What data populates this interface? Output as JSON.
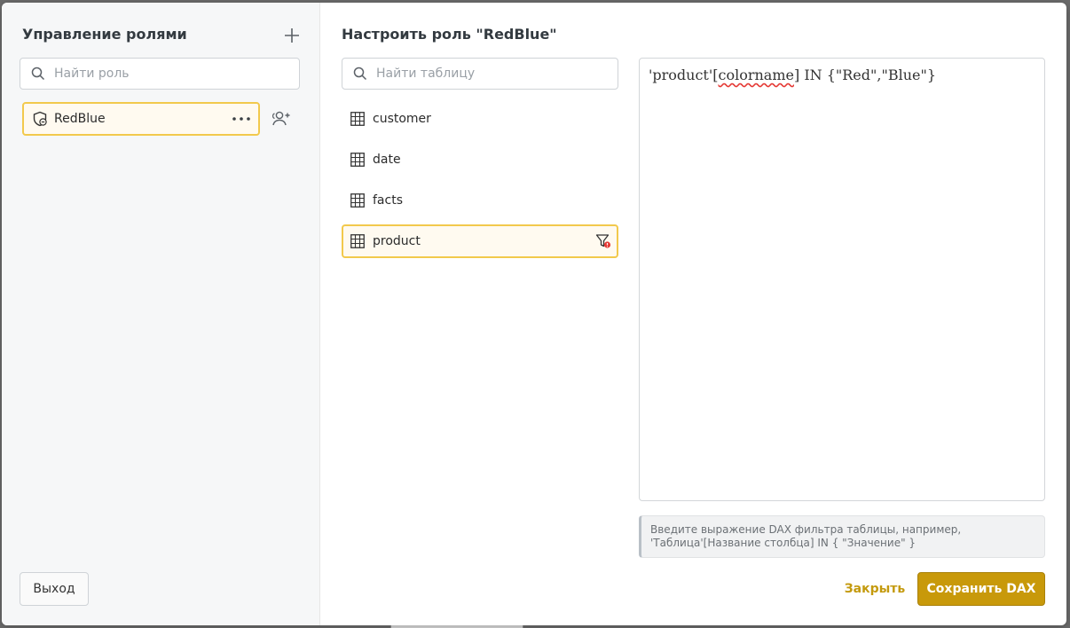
{
  "left_panel": {
    "title": "Управление ролями",
    "search_placeholder": "Найти роль",
    "roles": [
      {
        "label": "RedBlue"
      }
    ],
    "exit_label": "Выход"
  },
  "right_panel": {
    "title": "Настроить роль \"RedBlue\"",
    "search_placeholder": "Найти таблицу",
    "tables": [
      {
        "label": "customer"
      },
      {
        "label": "date"
      },
      {
        "label": "facts"
      },
      {
        "label": "product"
      }
    ],
    "selected_table": "product",
    "editor": {
      "code_prefix": "'product'[",
      "code_spell": "colorname",
      "code_suffix": "] IN {\"Red\",\"Blue\"}"
    },
    "hint_line1": "Введите выражение DAX фильтра таблицы, например,",
    "hint_line2": "'Таблица'[Название столбца] IN { \"Значение\" }",
    "close_label": "Закрыть",
    "save_label": "Сохранить DAX"
  },
  "colors": {
    "accent": "#c8990a",
    "selection_border": "#f2c94c",
    "selection_bg": "#fffaf0",
    "spell_error": "#e53935"
  },
  "icons": {
    "add": "plus-icon",
    "search": "search-icon",
    "role": "shield-icon",
    "more": "more-dots-icon",
    "users": "add-user-icon",
    "table": "table-grid-icon",
    "filter": "filter-icon"
  }
}
